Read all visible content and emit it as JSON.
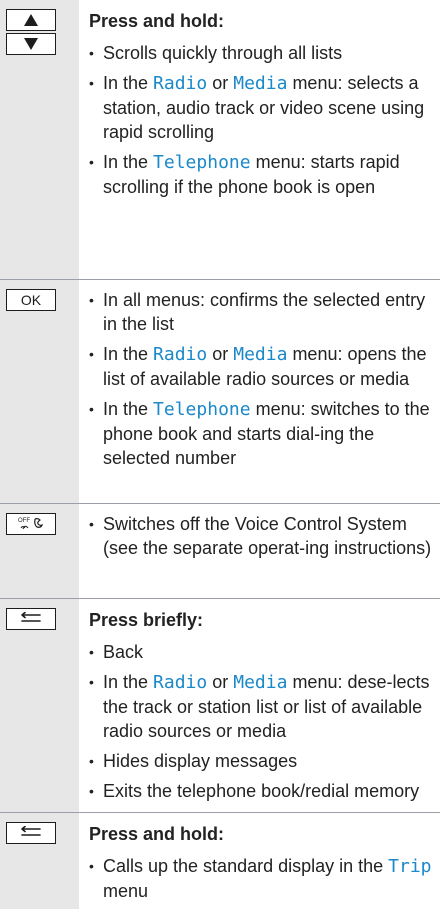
{
  "rows": [
    {
      "keys": [
        {
          "icon": "up-arrow-icon"
        },
        {
          "icon": "down-arrow-icon"
        }
      ],
      "heading": "Press and hold:",
      "bullets": [
        {
          "parts": [
            {
              "text": "Scrolls quickly through all lists"
            }
          ]
        },
        {
          "parts": [
            {
              "text": "In the "
            },
            {
              "text": "Radio",
              "hl": true
            },
            {
              "text": " or "
            },
            {
              "text": "Media",
              "hl": true
            },
            {
              "text": " menu: selects a station, audio track or video scene using rapid scrolling"
            }
          ]
        },
        {
          "parts": [
            {
              "text": "In the "
            },
            {
              "text": "Telephone",
              "hl": true
            },
            {
              "text": " menu: starts rapid scrolling if the phone book is open"
            }
          ]
        }
      ]
    },
    {
      "keys": [
        {
          "label": "OK"
        }
      ],
      "heading": "",
      "bullets": [
        {
          "parts": [
            {
              "text": "In all menus: confirms the selected entry in the list"
            }
          ]
        },
        {
          "parts": [
            {
              "text": "In the "
            },
            {
              "text": "Radio",
              "hl": true
            },
            {
              "text": " or "
            },
            {
              "text": "Media",
              "hl": true
            },
            {
              "text": " menu: opens the list of available radio sources or media"
            }
          ]
        },
        {
          "parts": [
            {
              "text": "In the "
            },
            {
              "text": "Telephone",
              "hl": true
            },
            {
              "text": " menu: switches to the phone book and starts dial-ing the selected number"
            }
          ]
        }
      ]
    },
    {
      "keys": [
        {
          "icon": "voice-control-off-icon"
        }
      ],
      "heading": "",
      "bullets": [
        {
          "parts": [
            {
              "text": "Switches off the Voice Control System (see the separate operat-ing instructions)"
            }
          ]
        }
      ]
    },
    {
      "keys": [
        {
          "icon": "back-icon"
        }
      ],
      "heading": "Press briefly:",
      "bullets": [
        {
          "parts": [
            {
              "text": "Back"
            }
          ]
        },
        {
          "parts": [
            {
              "text": "In the "
            },
            {
              "text": "Radio",
              "hl": true
            },
            {
              "text": " or "
            },
            {
              "text": "Media",
              "hl": true
            },
            {
              "text": " menu: dese-lects the track or station list or list of available radio sources or media"
            }
          ]
        },
        {
          "parts": [
            {
              "text": "Hides display messages"
            }
          ]
        },
        {
          "parts": [
            {
              "text": "Exits the telephone book/redial memory"
            }
          ]
        }
      ]
    },
    {
      "keys": [
        {
          "icon": "back-icon"
        }
      ],
      "heading": "Press and hold:",
      "bullets": [
        {
          "parts": [
            {
              "text": "Calls up the standard display in the "
            },
            {
              "text": "Trip",
              "hl": true
            },
            {
              "text": " menu"
            }
          ]
        }
      ]
    }
  ]
}
